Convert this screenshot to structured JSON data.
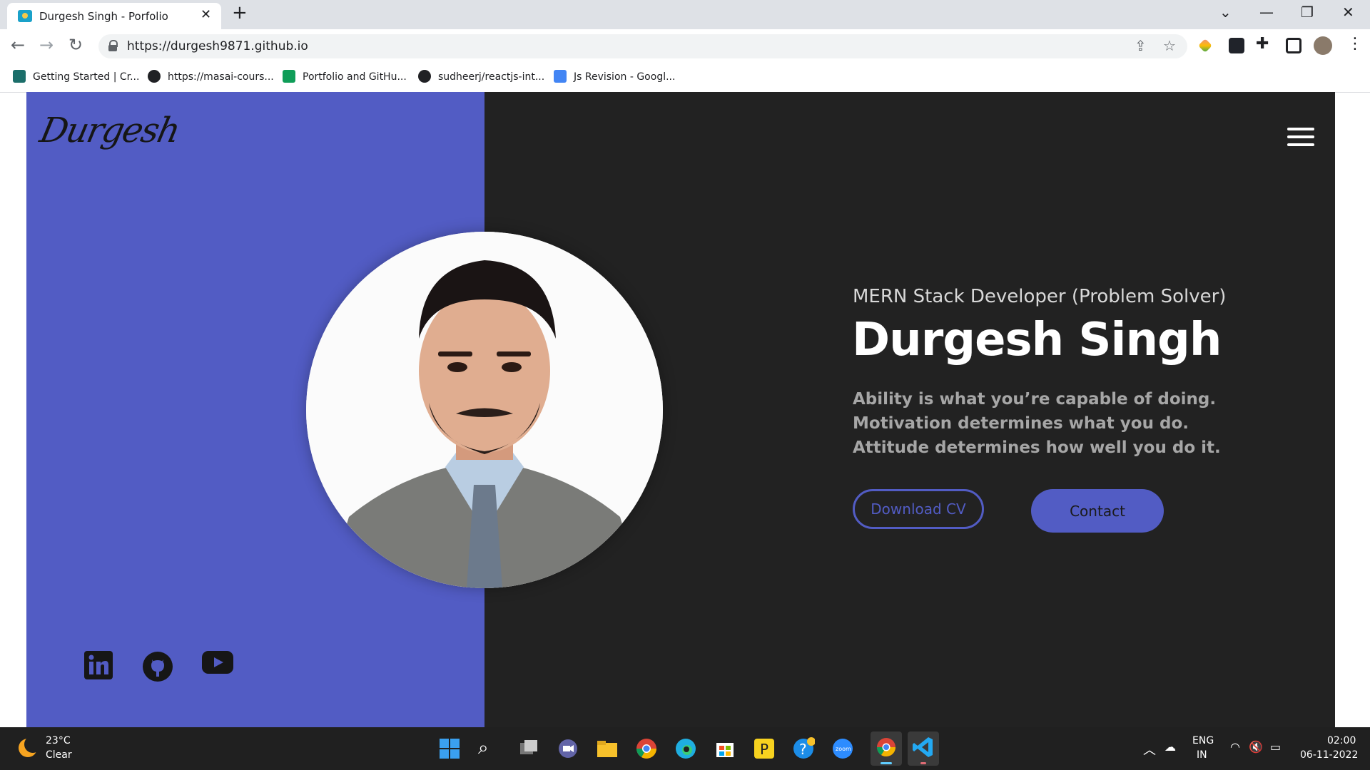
{
  "browser": {
    "tab_title": "Durgesh Singh - Porfolio",
    "url": "https://durgesh9871.github.io",
    "bookmarks": [
      {
        "label": "Getting Started | Cr...",
        "color": "#1b6e6a"
      },
      {
        "label": "https://masai-cours...",
        "color": "#202124"
      },
      {
        "label": "Portfolio and GitHu...",
        "color": "#0f9d58"
      },
      {
        "label": "sudheerj/reactjs-int...",
        "color": "#202124"
      },
      {
        "label": "Js Revision - Googl...",
        "color": "#4285f4"
      }
    ]
  },
  "site": {
    "logo_text": "Durgesh",
    "subtitle": "MERN Stack Developer (Problem Solver)",
    "name": "Durgesh Singh",
    "quote": "Ability is what you’re capable of doing. Motivation determines what you do. Attitude determines how well you do it.",
    "download_label": "Download CV",
    "contact_label": "Contact",
    "accent_color": "#525cc4",
    "dark_color": "#222222",
    "social": [
      "linkedin-icon",
      "github-icon",
      "youtube-icon"
    ]
  },
  "taskbar": {
    "temperature": "23°C",
    "condition": "Clear",
    "language_top": "ENG",
    "language_bottom": "IN",
    "time": "02:00",
    "date": "06-11-2022"
  }
}
